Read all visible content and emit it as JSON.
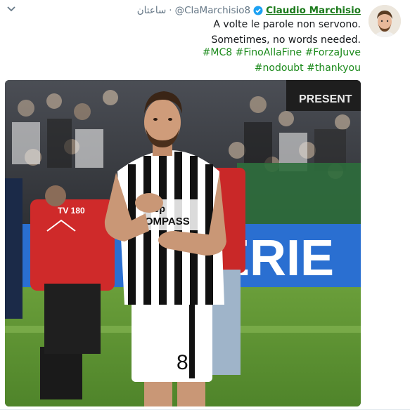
{
  "tweet": {
    "author_name": "Claudio Marchisio",
    "handle": "@ClaMarchisio8",
    "separator": "·",
    "time": "ساعتان",
    "text_line1": "A volte le parole non servono.",
    "text_line2": "Sometimes, no words needed.",
    "hashtags_line1": [
      "#MC8",
      "#FinoAllaFine",
      "#ForzaJuve"
    ],
    "hashtags_line2": [
      "#nodoubt",
      "#thankyou"
    ],
    "verified": true,
    "photo": {
      "shirt_sponsor_line1": "Jeep",
      "shirt_sponsor_line2": "COMPASS",
      "shirt_number": "8",
      "banner_text": "ERIE",
      "bib_text": "TV 180",
      "background_banner_text": "PRESENT"
    }
  },
  "colors": {
    "name_green": "#1b7a1b",
    "hashtag_green": "#1b8a1b",
    "verified_blue": "#1da1f2",
    "muted_text": "#657786"
  },
  "icons": {
    "caret": "chevron-down-icon",
    "verified": "verified-badge-icon"
  }
}
